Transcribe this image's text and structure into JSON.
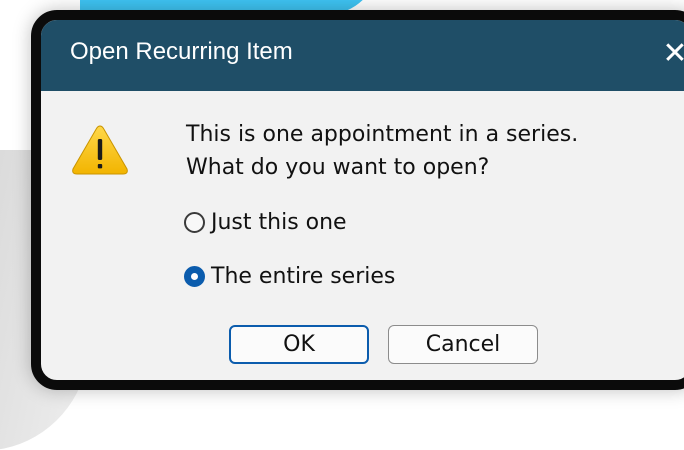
{
  "dialog": {
    "title": "Open Recurring Item",
    "close_glyph": "✕",
    "icon": "warning-icon",
    "message_line1": "This is one appointment in a series.",
    "message_line2": "What do you want to open?",
    "options": [
      {
        "label": "Just this one",
        "selected": false
      },
      {
        "label": "The entire series",
        "selected": true
      }
    ],
    "ok_label": "OK",
    "cancel_label": "Cancel"
  },
  "colors": {
    "titlebar": "#1f4e67",
    "accent": "#0b5cad",
    "warning": "#f5c518"
  }
}
